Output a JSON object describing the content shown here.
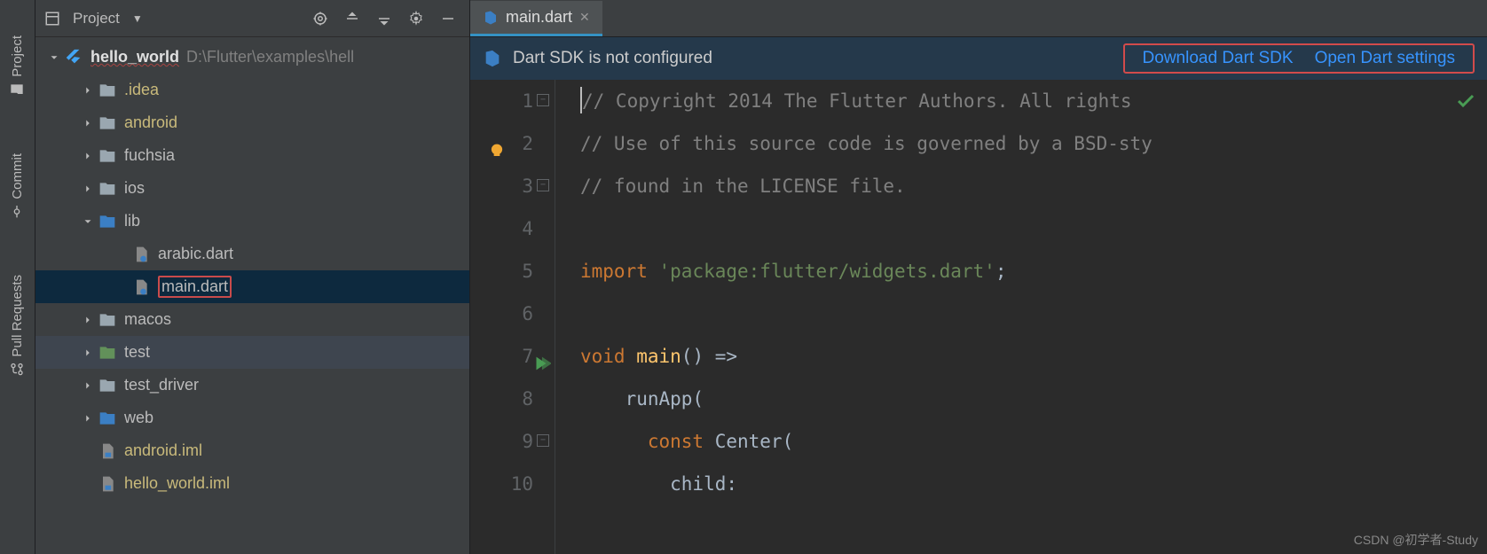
{
  "rail": {
    "items": [
      {
        "label": "Project",
        "icon": "folder-icon"
      },
      {
        "label": "Commit",
        "icon": "commit-icon"
      },
      {
        "label": "Pull Requests",
        "icon": "pull-request-icon"
      }
    ]
  },
  "panel": {
    "title": "Project",
    "icons": [
      "target-icon",
      "expand-icon",
      "collapse-icon",
      "gear-icon",
      "minimize-icon"
    ]
  },
  "tree": {
    "root": {
      "label": "hello_world",
      "path": "D:\\Flutter\\examples\\hell"
    },
    "items": [
      {
        "label": ".idea",
        "indent": 1,
        "icon": "folder-dot-icon",
        "chev": "right",
        "warn": true
      },
      {
        "label": "android",
        "indent": 1,
        "icon": "folder-alt-icon",
        "chev": "right",
        "warn": true
      },
      {
        "label": "fuchsia",
        "indent": 1,
        "icon": "folder-icon",
        "chev": "right"
      },
      {
        "label": "ios",
        "indent": 1,
        "icon": "folder-icon",
        "chev": "right"
      },
      {
        "label": "lib",
        "indent": 1,
        "icon": "folder-blue-icon",
        "chev": "down"
      },
      {
        "label": "arabic.dart",
        "indent": 2,
        "icon": "dart-file-icon",
        "chev": "none"
      },
      {
        "label": "main.dart",
        "indent": 2,
        "icon": "dart-file-icon",
        "chev": "none",
        "selected": true,
        "boxed": true
      },
      {
        "label": "macos",
        "indent": 1,
        "icon": "folder-icon",
        "chev": "right"
      },
      {
        "label": "test",
        "indent": 1,
        "icon": "folder-test-icon",
        "chev": "right",
        "hover": true
      },
      {
        "label": "test_driver",
        "indent": 1,
        "icon": "folder-icon",
        "chev": "right"
      },
      {
        "label": "web",
        "indent": 1,
        "icon": "folder-web-icon",
        "chev": "right"
      },
      {
        "label": "android.iml",
        "indent": 1,
        "icon": "iml-file-icon",
        "chev": "none",
        "warn": true
      },
      {
        "label": "hello_world.iml",
        "indent": 1,
        "icon": "iml-file-icon",
        "chev": "none",
        "warn": true
      }
    ]
  },
  "tabs": {
    "active": {
      "label": "main.dart",
      "icon": "dart-file-icon"
    }
  },
  "notification": {
    "message": "Dart SDK is not configured",
    "links": [
      "Download Dart SDK",
      "Open Dart settings"
    ]
  },
  "gutter": {
    "lines": [
      "1",
      "2",
      "3",
      "4",
      "5",
      "6",
      "7",
      "8",
      "9",
      "10"
    ]
  },
  "code": {
    "l1_a": "// Copyright 2014 The Flutter Authors. All rights",
    "l2_a": "// Use of this source code is governed by a BSD-sty",
    "l3_a": "// found in the LICENSE file.",
    "l5_kw": "import ",
    "l5_str": "'package:flutter/widgets.dart'",
    "l5_semi": ";",
    "l7_kw": "void ",
    "l7_fn": "main",
    "l7_rest": "() =>",
    "l8_a": "    runApp(",
    "l9_kw": "      const ",
    "l9_cls": "Center",
    "l9_p": "(",
    "l10_a": "        child:"
  },
  "watermark": "CSDN @初学者-Study"
}
